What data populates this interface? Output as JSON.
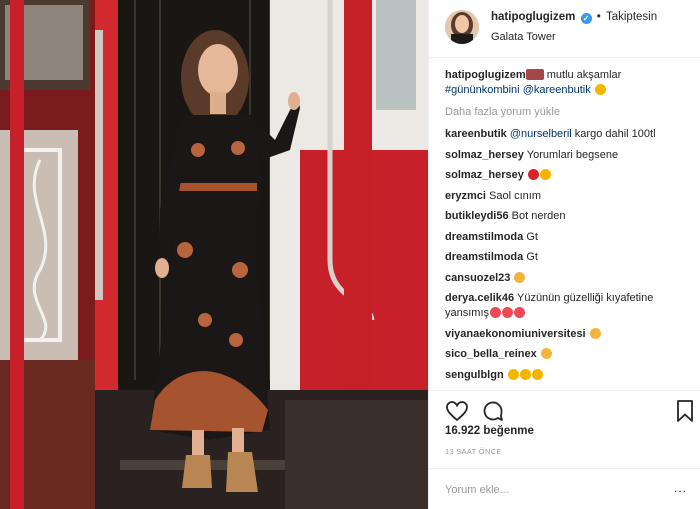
{
  "header": {
    "username": "hatipoglugizem",
    "follow_status": "Takiptesin",
    "location": "Galata Tower",
    "verified_icon": "verified-badge-icon"
  },
  "caption": {
    "username": "hatipoglugizem",
    "text": " mutlu akşamlar",
    "hashtag": "#gününkombini",
    "mention": "@kareenbutik"
  },
  "load_more": "Daha fazla yorum yükle",
  "comments": [
    {
      "user": "kareenbutik",
      "mention": "@nurselberil",
      "text": " kargo dahil 100tl",
      "emojis": []
    },
    {
      "user": "solmaz_hersey",
      "mention": "",
      "text": "Yorumlari begsene",
      "emojis": []
    },
    {
      "user": "solmaz_hersey",
      "mention": "",
      "text": "",
      "emojis": [
        "kiss-lips-icon",
        "grin-icon"
      ]
    },
    {
      "user": "eryzmci",
      "mention": "",
      "text": "Saol cınım",
      "emojis": []
    },
    {
      "user": "butikleydi56",
      "mention": "",
      "text": "Bot nerden",
      "emojis": []
    },
    {
      "user": "dreamstilmoda",
      "mention": "",
      "text": "Gt",
      "emojis": []
    },
    {
      "user": "dreamstilmoda",
      "mention": "",
      "text": "Gt",
      "emojis": []
    },
    {
      "user": "cansuozel23",
      "mention": "",
      "text": "",
      "emojis": [
        "ok-hand-icon"
      ]
    },
    {
      "user": "derya.celik46",
      "mention": "",
      "text": "Yüzünün güzelliği kıyafetine yansımış",
      "emojis": [
        "heart-icon",
        "heart-icon",
        "heart-icon"
      ]
    },
    {
      "user": "viyanaekonomiuniversitesi",
      "mention": "",
      "text": "",
      "emojis": [
        "thumbs-up-icon"
      ]
    },
    {
      "user": "sico_bella_reinex",
      "mention": "",
      "text": "",
      "emojis": [
        "ok-hand-icon"
      ]
    },
    {
      "user": "sengulblgn",
      "mention": "",
      "text": "",
      "emojis": [
        "smile-icon",
        "smile-icon",
        "smile-icon"
      ]
    }
  ],
  "likes": "16.922 beğenme",
  "timestamp": "13 SAAT ÖNCE",
  "comment_input": {
    "placeholder": "Yorum ekle...",
    "value": ""
  },
  "more_options": "...",
  "colors": {
    "tram_red": "#c8202a",
    "link_blue": "#003569",
    "verified_blue": "#3897f0",
    "muted_gray": "#999999",
    "heart_red": "#ed4956"
  }
}
